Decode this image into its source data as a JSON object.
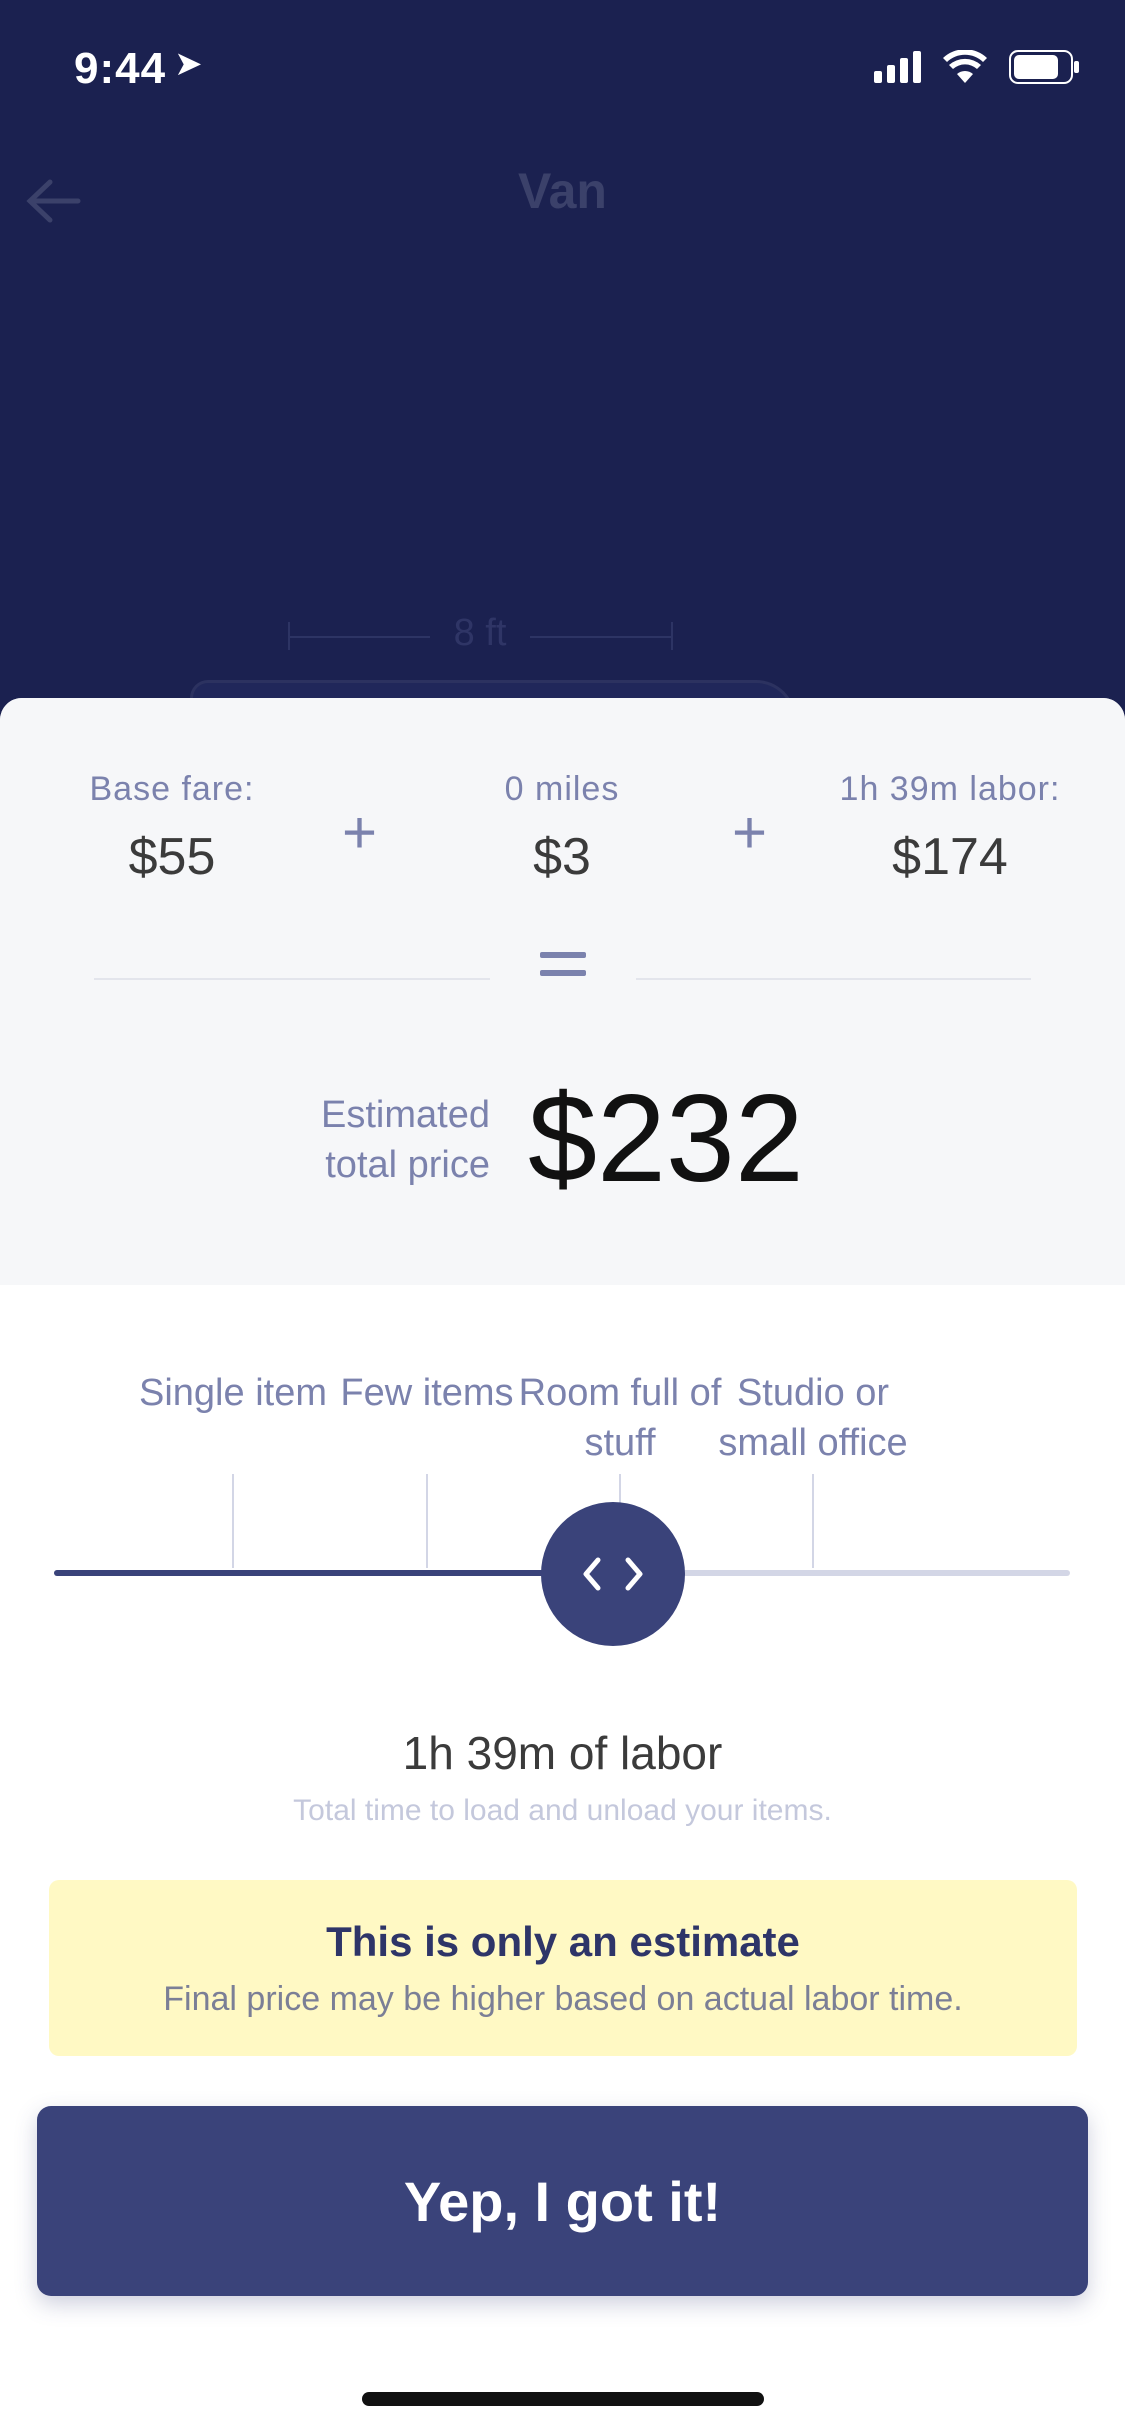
{
  "status_bar": {
    "time": "9:44"
  },
  "background_screen": {
    "title": "Van",
    "dimension_label": "8 ft"
  },
  "price_breakdown": {
    "items": [
      {
        "label": "Base fare:",
        "value": "$55"
      },
      {
        "label": "0 miles",
        "value": "$3"
      },
      {
        "label": "1h 39m labor:",
        "value": "$174"
      }
    ],
    "estimated_label": "Estimated total price",
    "estimated_value": "$232"
  },
  "labor_slider": {
    "ticks": [
      {
        "label": "Single item"
      },
      {
        "label": "Few items"
      },
      {
        "label": "Room full of stuff"
      },
      {
        "label": "Studio or small office"
      }
    ],
    "position_fraction": 0.55
  },
  "labor_summary": {
    "title": "1h 39m of labor",
    "subtitle": "Total time to load and unload your items."
  },
  "notice": {
    "title": "This is only an estimate",
    "subtitle": "Final price may be higher based on actual labor time."
  },
  "cta": {
    "label": "Yep, I got it!"
  },
  "colors": {
    "navy": "#1b2150",
    "accent": "#3a437a",
    "muted_label": "#7b82ad",
    "notice_bg": "#fff9c4"
  }
}
